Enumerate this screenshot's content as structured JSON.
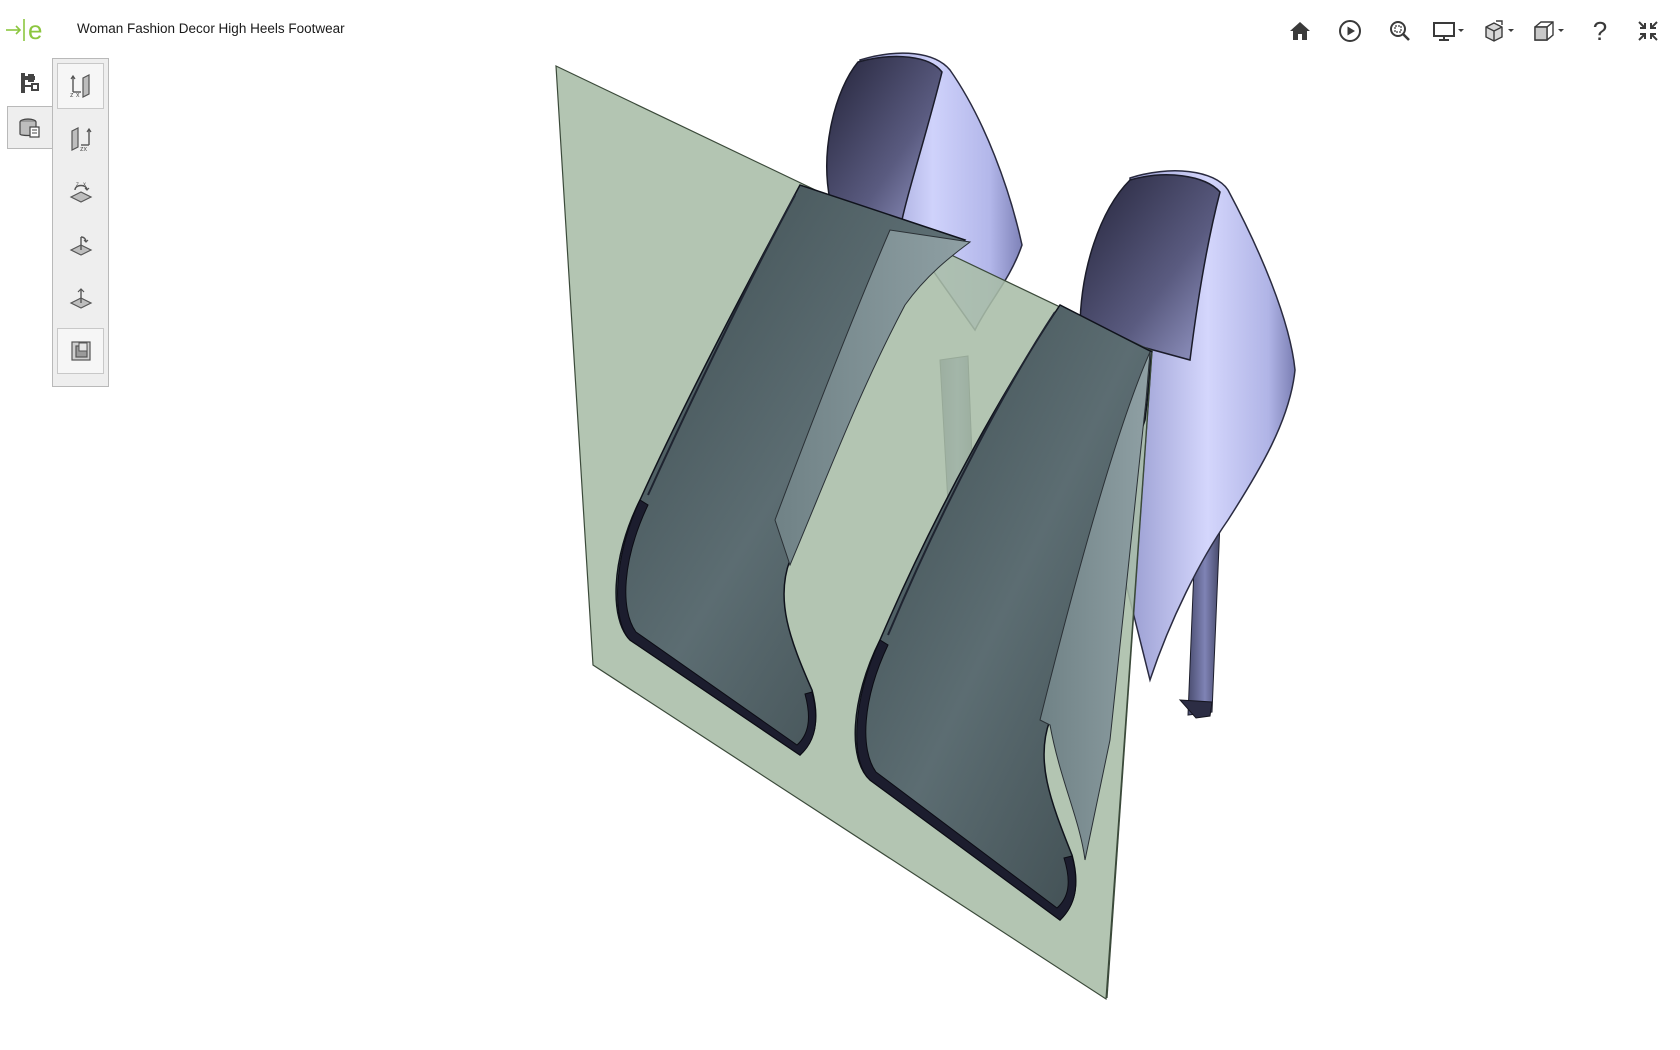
{
  "document": {
    "title": "Woman Fashion Decor High Heels Footwear"
  },
  "logo": {
    "letter": "e",
    "icon": "arrow-e-logo",
    "color": "#8cc63f"
  },
  "toolbar": {
    "items": [
      {
        "name": "home-icon"
      },
      {
        "name": "play-icon"
      },
      {
        "name": "zoom-fit-icon"
      },
      {
        "name": "display-mode-icon",
        "dropdown": true
      },
      {
        "name": "explode-icon",
        "dropdown": true
      },
      {
        "name": "standard-views-icon",
        "dropdown": true
      },
      {
        "name": "help-icon",
        "label": "?"
      },
      {
        "name": "fullscreen-exit-icon"
      }
    ]
  },
  "left_panel": {
    "tabs": [
      {
        "name": "model-tree-icon",
        "active": false
      },
      {
        "name": "views-icon",
        "active": true
      }
    ],
    "view_buttons": [
      {
        "name": "front-view-icon",
        "framed": true
      },
      {
        "name": "back-view-icon",
        "framed": false
      },
      {
        "name": "top-view-icon",
        "framed": false
      },
      {
        "name": "left-view-icon",
        "framed": false
      },
      {
        "name": "bottom-view-icon",
        "framed": false
      },
      {
        "name": "isometric-view-icon",
        "framed": true
      }
    ]
  },
  "scene": {
    "model": "pair of high heel shoes, cross-section view",
    "shoe_color": "#b9bdf0",
    "section_plane_color": "#a9bda7"
  }
}
